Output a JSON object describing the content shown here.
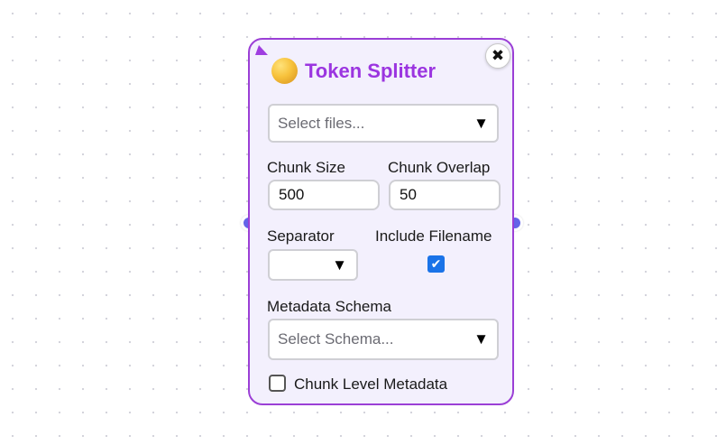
{
  "node": {
    "title": "Token Splitter",
    "close_glyph": "✖",
    "files": {
      "placeholder": "Select files...",
      "arrow": "▼"
    },
    "chunk_size": {
      "label": "Chunk Size",
      "value": "500"
    },
    "chunk_overlap": {
      "label": "Chunk Overlap",
      "value": "50"
    },
    "separator": {
      "label": "Separator",
      "value": "",
      "arrow": "▼"
    },
    "include_filename": {
      "label": "Include Filename",
      "checked": true,
      "check_glyph": "✔"
    },
    "metadata_schema": {
      "label": "Metadata Schema",
      "placeholder": "Select Schema...",
      "arrow": "▼"
    },
    "chunk_level_metadata": {
      "label": "Chunk Level Metadata",
      "checked": false
    }
  },
  "colors": {
    "accent": "#9b35e0",
    "node_background": "#f3f0fd",
    "handle": "#6464e8",
    "checkbox": "#1a73e8"
  }
}
